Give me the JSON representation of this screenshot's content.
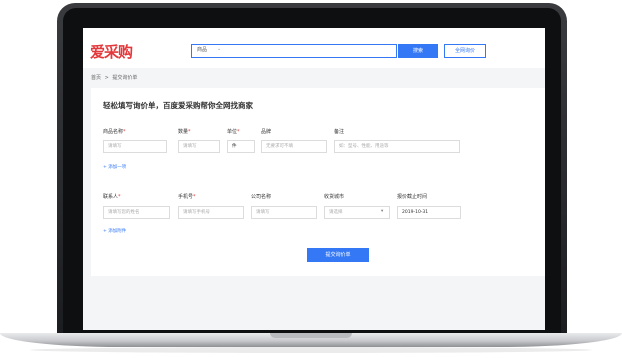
{
  "header": {
    "logo": "爱采购",
    "search_category": "商品",
    "search_caret": "⌄",
    "search_button": "搜索",
    "all_net_button": "全网询价"
  },
  "breadcrumb": {
    "home": "首页",
    "separator": ">",
    "current": "提交询价单"
  },
  "form": {
    "title": "轻松填写询价单，百度爱采购帮你全网找商家",
    "product": {
      "name_label": "商品名称",
      "name_placeholder": "请填写",
      "qty_label": "数量",
      "qty_placeholder": "请填写",
      "unit_label": "单位",
      "unit_value": "件",
      "brand_label": "品牌",
      "brand_placeholder": "无要求可不填",
      "note_label": "备注",
      "note_placeholder": "如：型号、性能、用途等",
      "add_item": "+ 添加一项"
    },
    "contact": {
      "name_label": "联系人",
      "name_placeholder": "请填写您的姓名",
      "phone_label": "手机号",
      "phone_placeholder": "请填写手机号",
      "company_label": "公司名称",
      "company_placeholder": "请填写",
      "city_label": "收货城市",
      "city_placeholder": "请选择",
      "city_caret": "▾",
      "deadline_label": "报价截止时间",
      "deadline_value": "2019-10-31",
      "add_attachment": "+ 添加附件"
    },
    "required_mark": "*",
    "submit": "提交询价单"
  },
  "colors": {
    "accent": "#3478f6",
    "brand": "#e4393c"
  }
}
